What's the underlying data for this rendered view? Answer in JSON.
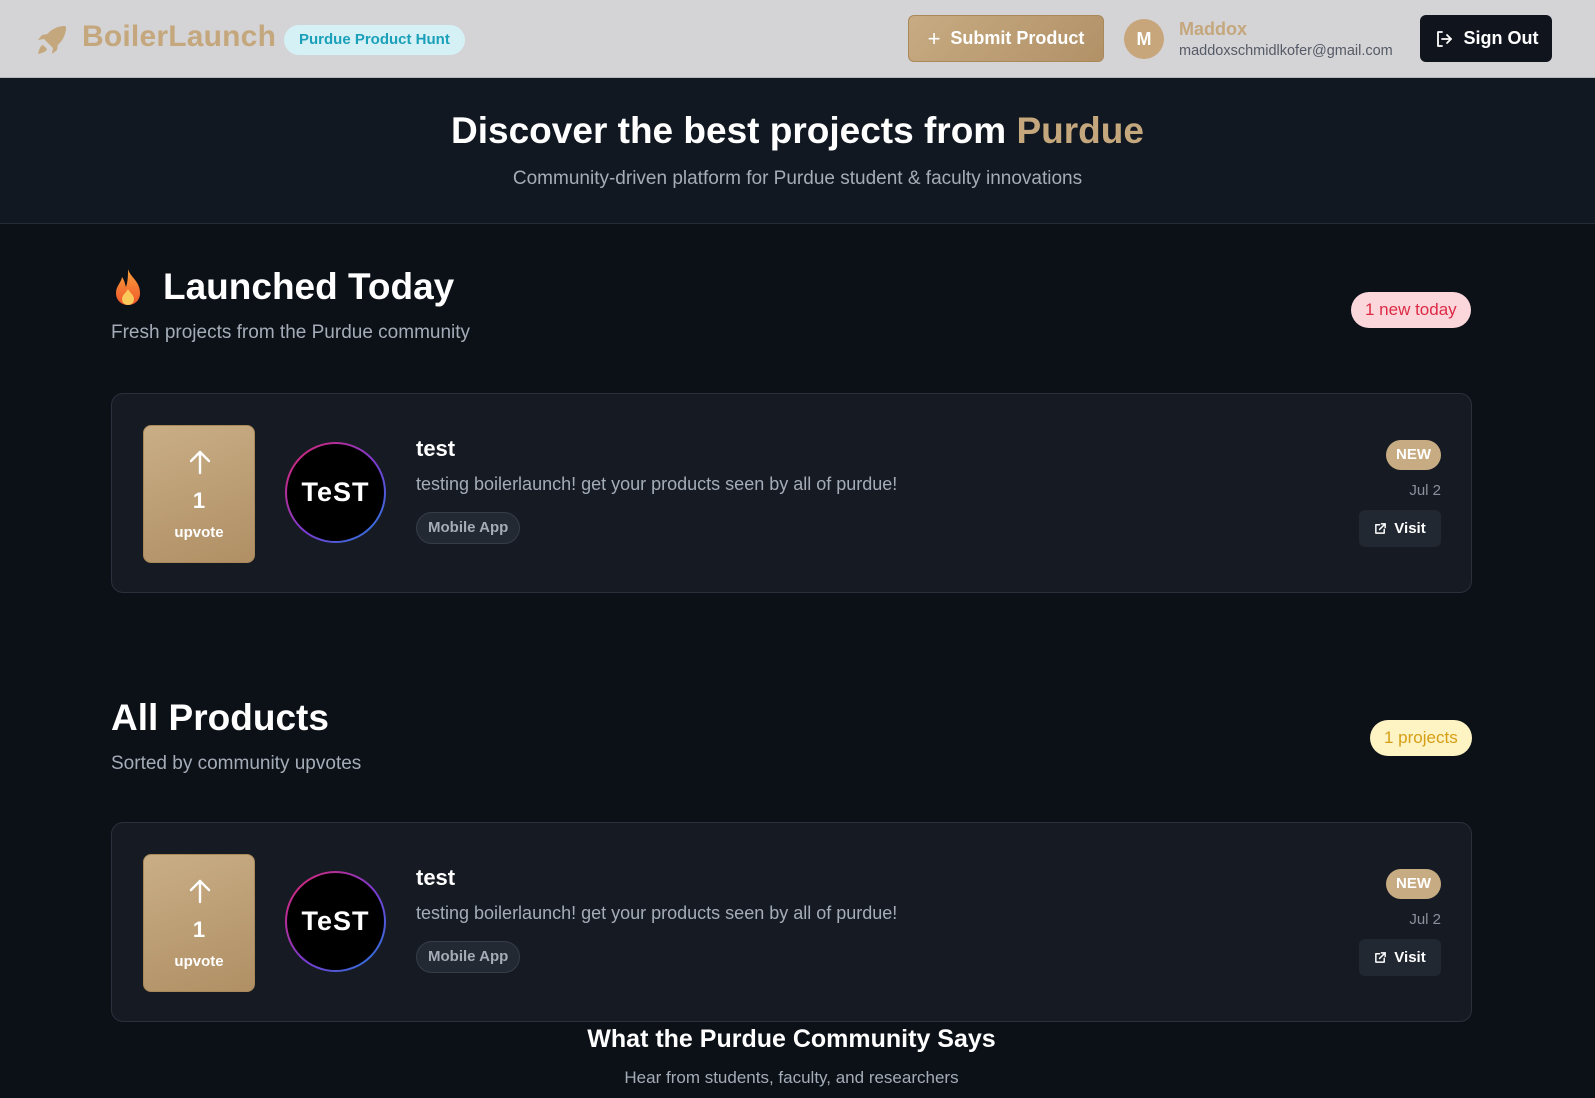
{
  "header": {
    "brand_name": "BoilerLaunch",
    "brand_badge": "Purdue Product Hunt",
    "submit_label": "Submit Product",
    "user": {
      "initial": "M",
      "name": "Maddox",
      "email": "maddoxschmidlkofer@gmail.com"
    },
    "signout_label": "Sign Out"
  },
  "hero": {
    "title_prefix": "Discover the best projects from ",
    "title_accent": "Purdue",
    "subtitle": "Community-driven platform for Purdue student & faculty innovations"
  },
  "launched_today": {
    "title": "Launched Today",
    "subtitle": "Fresh projects from the Purdue community",
    "count_badge": "1 new today",
    "products": [
      {
        "upvotes": "1",
        "upvote_label": "upvote",
        "logo_text": "TeST",
        "name": "test",
        "description": "testing boilerlaunch! get your products seen by all of purdue!",
        "tag": "Mobile App",
        "badge": "NEW",
        "date": "Jul 2",
        "visit_label": "Visit"
      }
    ]
  },
  "all_products": {
    "title": "All Products",
    "subtitle": "Sorted by community upvotes",
    "count_badge": "1 projects",
    "products": [
      {
        "upvotes": "1",
        "upvote_label": "upvote",
        "logo_text": "TeST",
        "name": "test",
        "description": "testing boilerlaunch! get your products seen by all of purdue!",
        "tag": "Mobile App",
        "badge": "NEW",
        "date": "Jul 2",
        "visit_label": "Visit"
      }
    ]
  },
  "testimonials": {
    "title": "What the Purdue Community Says",
    "subtitle": "Hear from students, faculty, and researchers"
  },
  "colors": {
    "gold": "#c4a77c",
    "background": "#0c1017",
    "header": "#d4d3d6",
    "red_badge": "#dc2a45",
    "yellow_badge": "#d69e14"
  },
  "icons": [
    "rocket-icon",
    "plus-icon",
    "sign-out-icon",
    "fire-icon",
    "arrow-up-icon",
    "external-link-icon"
  ]
}
